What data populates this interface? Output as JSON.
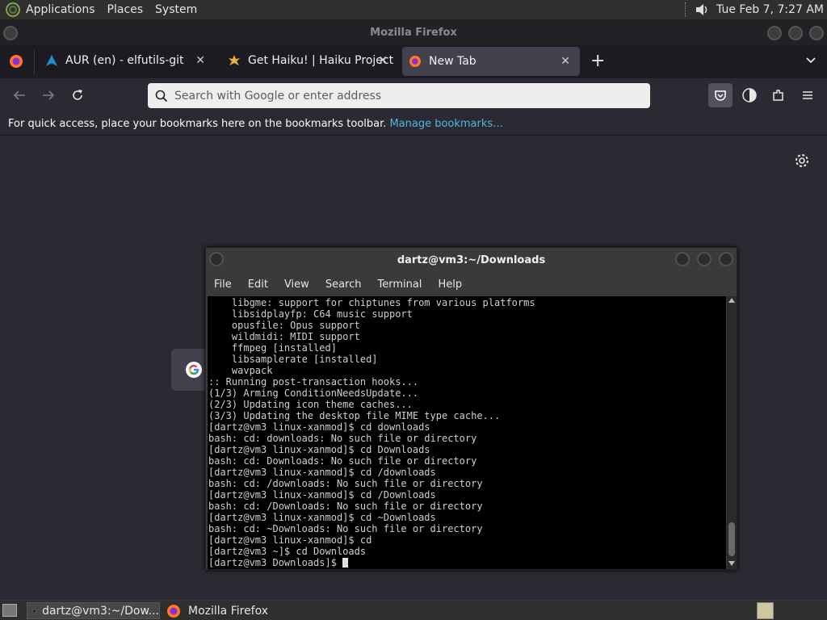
{
  "top_panel": {
    "menus": [
      "Applications",
      "Places",
      "System"
    ],
    "clock": "Tue Feb  7, 7:27 AM"
  },
  "firefox": {
    "window_title": "Mozilla Firefox",
    "tabs": [
      {
        "label": "AUR (en) - elfutils-git",
        "icon": "arch-icon",
        "active": false
      },
      {
        "label": "Get Haiku! | Haiku Project",
        "icon": "haiku-icon",
        "active": false
      },
      {
        "label": "New Tab",
        "icon": "firefox-icon",
        "active": true
      }
    ],
    "url_placeholder": "Search with Google or enter address",
    "bookmarks_text": "For quick access, place your bookmarks here on the bookmarks toolbar.",
    "bookmarks_link": "Manage bookmarks…"
  },
  "terminal": {
    "title": "dartz@vm3:~/Downloads",
    "menu": [
      "File",
      "Edit",
      "View",
      "Search",
      "Terminal",
      "Help"
    ],
    "lines": [
      "    libgme: support for chiptunes from various platforms",
      "    libsidplayfp: C64 music support",
      "    opusfile: Opus support",
      "    wildmidi: MIDI support",
      "    ffmpeg [installed]",
      "    libsamplerate [installed]",
      "    wavpack",
      ":: Running post-transaction hooks...",
      "(1/3) Arming ConditionNeedsUpdate...",
      "(2/3) Updating icon theme caches...",
      "(3/3) Updating the desktop file MIME type cache...",
      "[dartz@vm3 linux-xanmod]$ cd downloads",
      "bash: cd: downloads: No such file or directory",
      "[dartz@vm3 linux-xanmod]$ cd Downloads",
      "bash: cd: Downloads: No such file or directory",
      "[dartz@vm3 linux-xanmod]$ cd /downloads",
      "bash: cd: /downloads: No such file or directory",
      "[dartz@vm3 linux-xanmod]$ cd /Downloads",
      "bash: cd: /Downloads: No such file or directory",
      "[dartz@vm3 linux-xanmod]$ cd ~Downloads",
      "bash: cd: ~Downloads: No such file or directory",
      "[dartz@vm3 linux-xanmod]$ cd",
      "[dartz@vm3 ~]$ cd Downloads"
    ],
    "prompt": "[dartz@vm3 Downloads]$ "
  },
  "taskbar": {
    "items": [
      {
        "label": "dartz@vm3:~/Dow...",
        "icon": "terminal-icon",
        "active": true
      },
      {
        "label": "Mozilla Firefox",
        "icon": "firefox-icon",
        "active": false
      }
    ]
  }
}
